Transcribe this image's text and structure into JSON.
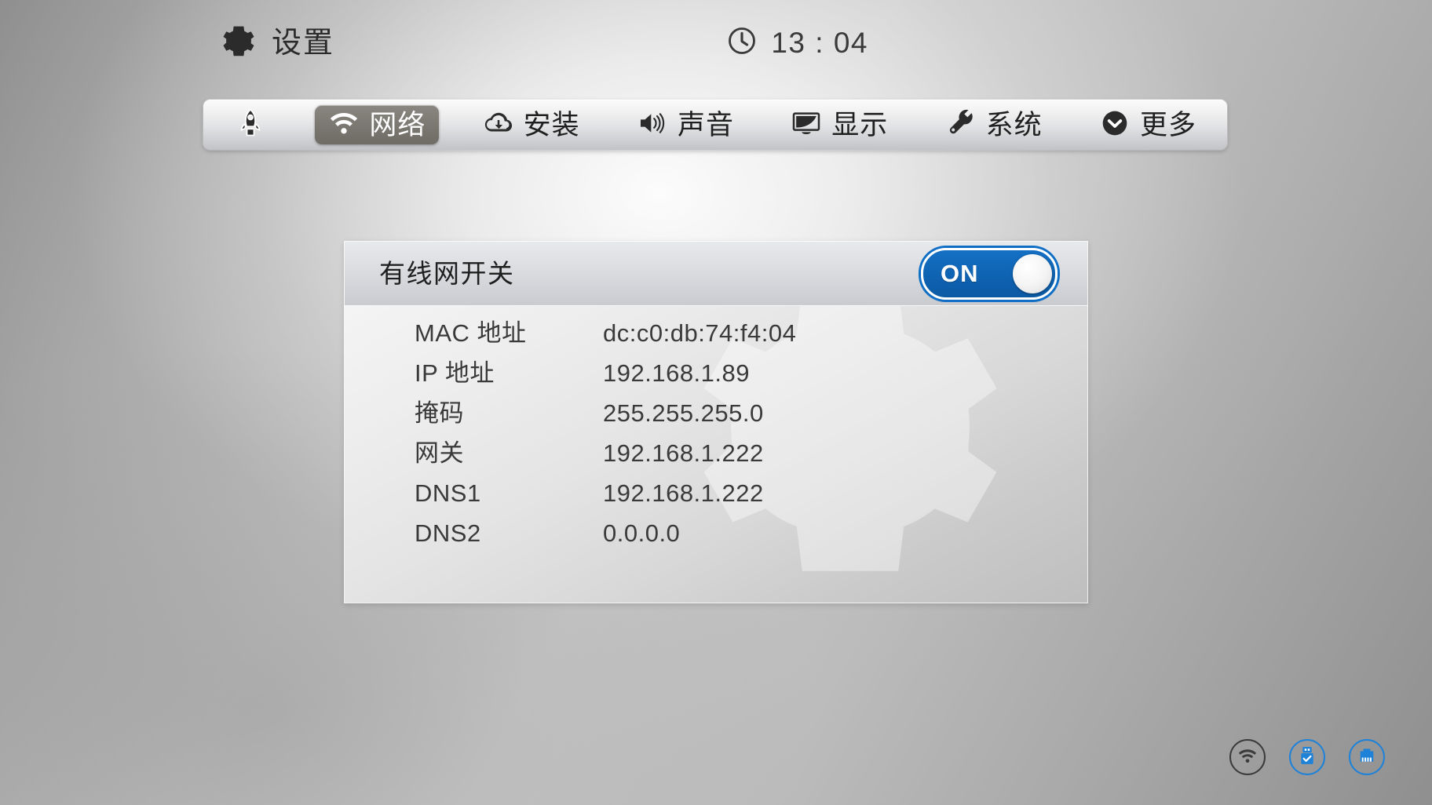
{
  "header": {
    "title": "设置",
    "gear_icon": "gear-icon",
    "clock_icon": "clock-icon",
    "time": "13 : 04"
  },
  "tabs": [
    {
      "id": "home",
      "label": "",
      "icon": "rocket-icon",
      "active": false
    },
    {
      "id": "network",
      "label": "网络",
      "icon": "wifi-icon",
      "active": true
    },
    {
      "id": "install",
      "label": "安装",
      "icon": "cloud-download-icon",
      "active": false
    },
    {
      "id": "sound",
      "label": "声音",
      "icon": "speaker-icon",
      "active": false
    },
    {
      "id": "display",
      "label": "显示",
      "icon": "monitor-icon",
      "active": false
    },
    {
      "id": "system",
      "label": "系统",
      "icon": "wrench-icon",
      "active": false
    },
    {
      "id": "more",
      "label": "更多",
      "icon": "chevron-down-icon",
      "active": false
    }
  ],
  "panel": {
    "header_title": "有线网开关",
    "toggle": {
      "label": "ON",
      "state": "on",
      "color": "#0f64b4"
    },
    "rows": [
      {
        "label": "MAC 地址",
        "value": "dc:c0:db:74:f4:04"
      },
      {
        "label": "IP 地址",
        "value": "192.168.1.89"
      },
      {
        "label": "掩码",
        "value": "255.255.255.0"
      },
      {
        "label": "网关",
        "value": "192.168.1.222"
      },
      {
        "label": "DNS1",
        "value": "192.168.1.222"
      },
      {
        "label": "DNS2",
        "value": "0.0.0.0"
      }
    ],
    "watermark_icon": "gear-watermark-icon"
  },
  "tray": [
    {
      "id": "wifi",
      "icon": "wifi-icon",
      "state": "inactive",
      "color": "#3b3b3b"
    },
    {
      "id": "usb",
      "icon": "usb-check-icon",
      "state": "active",
      "color": "#1e82d8"
    },
    {
      "id": "ethernet",
      "icon": "ethernet-icon",
      "state": "active",
      "color": "#1e82d8"
    }
  ]
}
